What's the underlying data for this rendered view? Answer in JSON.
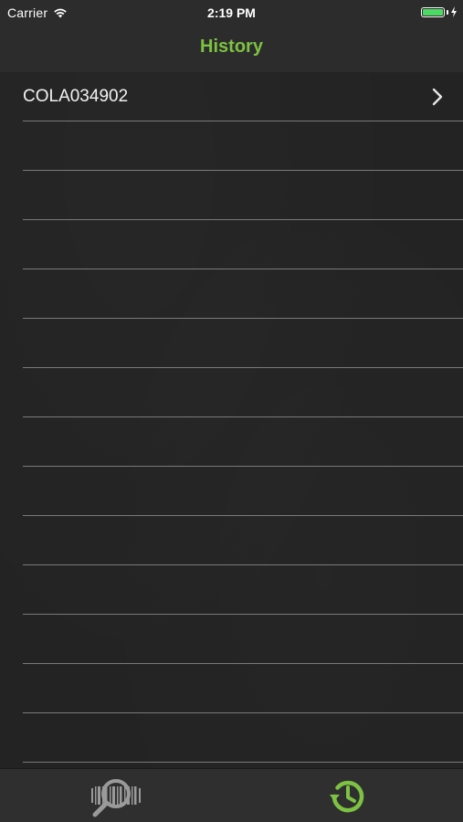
{
  "status_bar": {
    "carrier": "Carrier",
    "time": "2:19 PM",
    "battery_color": "#4cd964"
  },
  "nav": {
    "title": "History",
    "title_color": "#7dc242"
  },
  "history": {
    "items": [
      {
        "code": "COLA034902"
      },
      {
        "code": ""
      },
      {
        "code": ""
      },
      {
        "code": ""
      },
      {
        "code": ""
      },
      {
        "code": ""
      },
      {
        "code": ""
      },
      {
        "code": ""
      },
      {
        "code": ""
      },
      {
        "code": ""
      },
      {
        "code": ""
      },
      {
        "code": ""
      },
      {
        "code": ""
      },
      {
        "code": ""
      }
    ]
  },
  "tab_bar": {
    "tabs": [
      {
        "icon": "barcode-scan-icon",
        "selected": false
      },
      {
        "icon": "history-clock-icon",
        "selected": true
      }
    ],
    "selected_color": "#7dc242",
    "unselected_color": "#9a9a9a"
  }
}
